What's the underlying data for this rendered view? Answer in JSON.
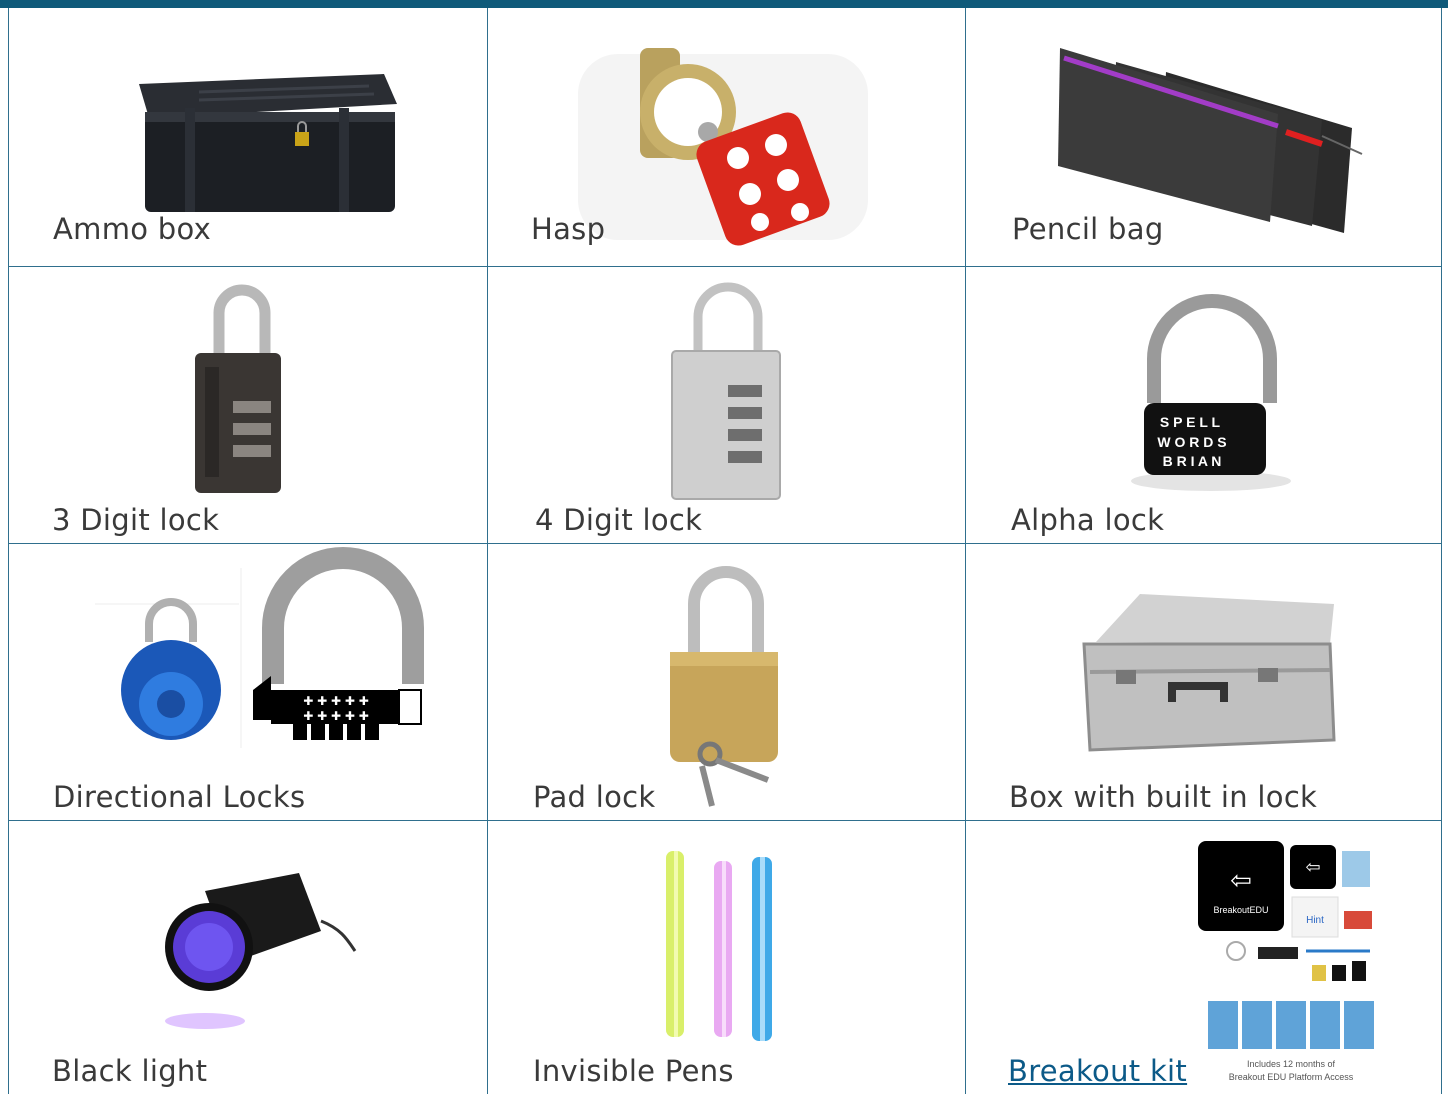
{
  "items": [
    {
      "label": "Ammo box"
    },
    {
      "label": "Hasp"
    },
    {
      "label": "Pencil bag"
    },
    {
      "label": "3 Digit lock"
    },
    {
      "label": "4 Digit lock"
    },
    {
      "label": "Alpha lock"
    },
    {
      "label": "Directional Locks"
    },
    {
      "label": "Pad lock"
    },
    {
      "label": "Box with built in lock"
    },
    {
      "label": "Black light"
    },
    {
      "label": "Invisible Pens"
    },
    {
      "label": "Breakout kit"
    }
  ],
  "alpha_lock_letters": [
    "S P E L L",
    "W O R D S",
    "B R I A N"
  ],
  "breakout_kit_image": {
    "brand": "BreakoutEDU",
    "hint": "Hint",
    "caption_line1": "Includes 12 months of",
    "caption_line2": "Breakout EDU Platform Access"
  },
  "colors": {
    "frame": "#0f5a7a",
    "gridline": "#2f6f8d",
    "label_text": "#3a3a3a",
    "link": "#0c5a88"
  }
}
